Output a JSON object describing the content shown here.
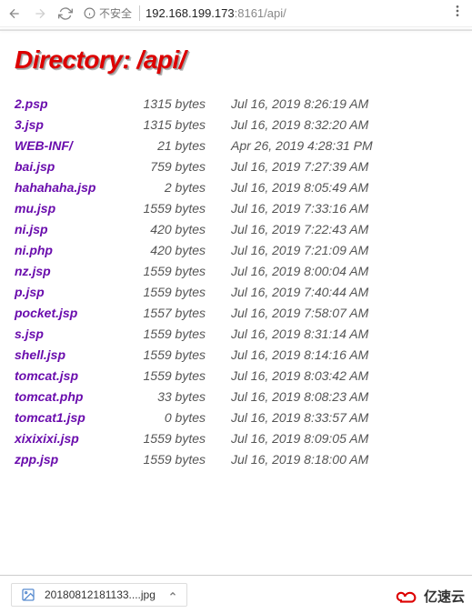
{
  "browser": {
    "insecure_label": "不安全",
    "url_host": "192.168.199.173",
    "url_port": ":8161",
    "url_path": "/api/"
  },
  "page": {
    "heading": "Directory: /api/"
  },
  "files": [
    {
      "name": "2.psp",
      "size": "1315 bytes",
      "date": "Jul 16, 2019 8:26:19 AM"
    },
    {
      "name": "3.jsp",
      "size": "1315 bytes",
      "date": "Jul 16, 2019 8:32:20 AM"
    },
    {
      "name": "WEB-INF/",
      "size": "21 bytes",
      "date": "Apr 26, 2019 4:28:31 PM"
    },
    {
      "name": "bai.jsp",
      "size": "759 bytes",
      "date": "Jul 16, 2019 7:27:39 AM"
    },
    {
      "name": "hahahaha.jsp",
      "size": "2 bytes",
      "date": "Jul 16, 2019 8:05:49 AM"
    },
    {
      "name": "mu.jsp",
      "size": "1559 bytes",
      "date": "Jul 16, 2019 7:33:16 AM"
    },
    {
      "name": "ni.jsp",
      "size": "420 bytes",
      "date": "Jul 16, 2019 7:22:43 AM"
    },
    {
      "name": "ni.php",
      "size": "420 bytes",
      "date": "Jul 16, 2019 7:21:09 AM"
    },
    {
      "name": "nz.jsp",
      "size": "1559 bytes",
      "date": "Jul 16, 2019 8:00:04 AM"
    },
    {
      "name": "p.jsp",
      "size": "1559 bytes",
      "date": "Jul 16, 2019 7:40:44 AM"
    },
    {
      "name": "pocket.jsp",
      "size": "1557 bytes",
      "date": "Jul 16, 2019 7:58:07 AM"
    },
    {
      "name": "s.jsp",
      "size": "1559 bytes",
      "date": "Jul 16, 2019 8:31:14 AM"
    },
    {
      "name": "shell.jsp",
      "size": "1559 bytes",
      "date": "Jul 16, 2019 8:14:16 AM"
    },
    {
      "name": "tomcat.jsp",
      "size": "1559 bytes",
      "date": "Jul 16, 2019 8:03:42 AM"
    },
    {
      "name": "tomcat.php",
      "size": "33 bytes",
      "date": "Jul 16, 2019 8:08:23 AM"
    },
    {
      "name": "tomcat1.jsp",
      "size": "0 bytes",
      "date": "Jul 16, 2019 8:33:57 AM"
    },
    {
      "name": "xixixixi.jsp",
      "size": "1559 bytes",
      "date": "Jul 16, 2019 8:09:05 AM"
    },
    {
      "name": "zpp.jsp",
      "size": "1559 bytes",
      "date": "Jul 16, 2019 8:18:00 AM"
    }
  ],
  "downloads": {
    "filename": "20180812181133....jpg"
  },
  "watermark": {
    "text": "亿速云"
  }
}
